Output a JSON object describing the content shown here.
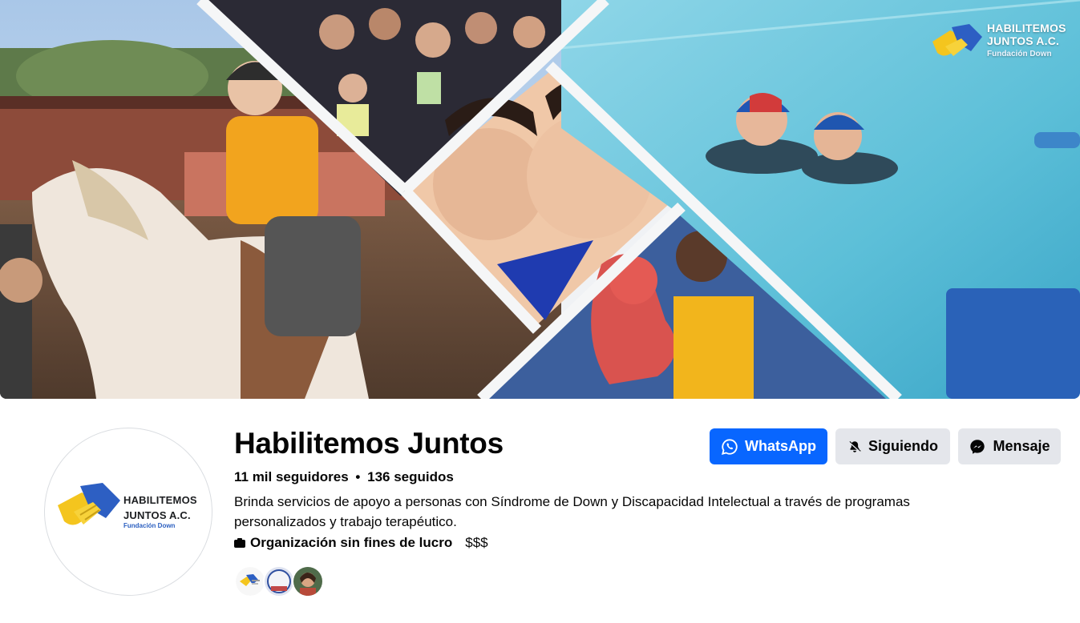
{
  "cover": {
    "logo_line1": "HABILITEMOS",
    "logo_line2": "JUNTOS A.C.",
    "logo_sub": "Fundación Down"
  },
  "profile": {
    "name": "Habilitemos Juntos",
    "followers": "11 mil seguidores",
    "separator": "•",
    "following": "136 seguidos",
    "bio": "Brinda servicios de apoyo a personas con Síndrome de Down y Discapacidad Intelectual a través de programas personalizados y trabajo terapéutico.",
    "category": "Organización sin fines de lucro",
    "price_range": "$$$",
    "avatar_line1": "HABILITEMOS",
    "avatar_line2": "JUNTOS A.C.",
    "avatar_sub": "Fundación Down"
  },
  "actions": {
    "whatsapp_label": "WhatsApp",
    "following_label": "Siguiendo",
    "message_label": "Mensaje"
  },
  "colors": {
    "primary_blue": "#0866ff",
    "secondary_button": "#e4e6eb",
    "text": "#050505"
  },
  "icons": [
    "whatsapp-icon",
    "bell-icon",
    "messenger-icon",
    "category-icon"
  ]
}
